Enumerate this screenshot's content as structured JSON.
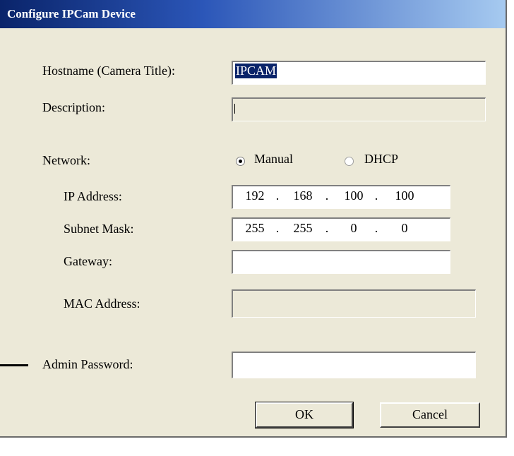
{
  "window": {
    "title": "Configure IPCam Device"
  },
  "labels": {
    "hostname": "Hostname (Camera Title):",
    "description": "Description:",
    "network": "Network:",
    "ip_address": "IP Address:",
    "subnet_mask": "Subnet Mask:",
    "gateway": "Gateway:",
    "mac_address": "MAC Address:",
    "admin_password": "Admin Password:"
  },
  "fields": {
    "hostname_value": "IPCAM",
    "description_value": "",
    "gateway_value": "",
    "mac_value": "",
    "password_value": ""
  },
  "network": {
    "manual_label": "Manual",
    "dhcp_label": "DHCP",
    "selected": "Manual"
  },
  "ip": {
    "o1": "192",
    "o2": "168",
    "o3": "100",
    "o4": "100"
  },
  "subnet": {
    "o1": "255",
    "o2": "255",
    "o3": "0",
    "o4": "0"
  },
  "buttons": {
    "ok": "OK",
    "cancel": "Cancel"
  },
  "colors": {
    "title_bar": "#0a246a",
    "dialog_bg": "#ece9d8",
    "selection": "#0a246a"
  }
}
